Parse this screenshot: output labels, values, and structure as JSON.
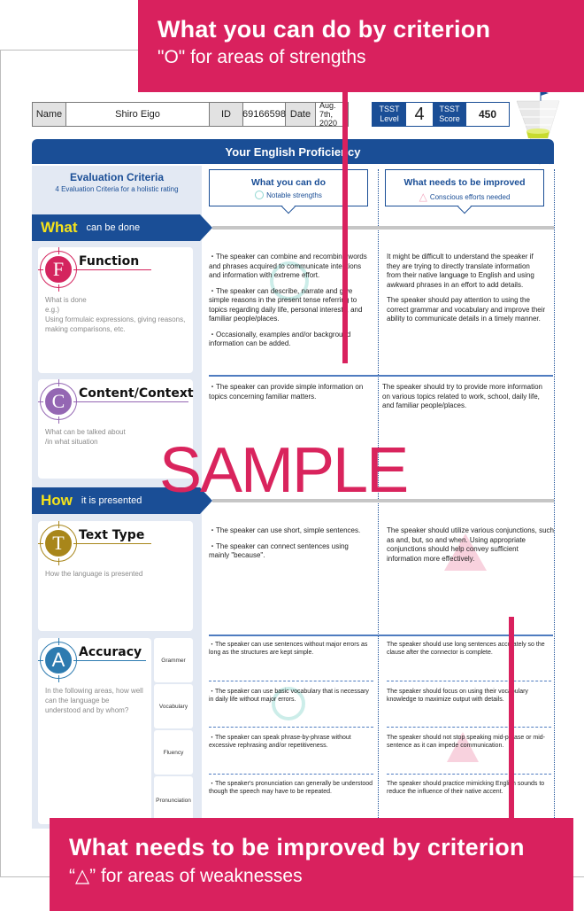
{
  "callouts": {
    "top": {
      "title": "What you can do by criterion",
      "subtitle": "\"O\" for areas of strengths"
    },
    "bottom": {
      "title": "What needs to be improved by criterion",
      "subtitle": "“△” for areas of weaknesses"
    }
  },
  "header": {
    "name_label": "Name",
    "name_value": "Shiro Eigo",
    "id_label": "ID",
    "id_value": "69166598",
    "date_label": "Date",
    "date_value": "Aug. 7th, 2020",
    "level_label": "TSST Level",
    "level_value": "4",
    "score_label": "TSST Score",
    "score_value": "450"
  },
  "title": "Your English Proficiency",
  "eval": {
    "title": "Evaluation Criteria",
    "subtitle": "4 Evaluation Criteria for a holistic rating"
  },
  "columns": {
    "can_do": {
      "title": "What you can do",
      "subtitle": "Notable strengths",
      "icon": "circle-icon"
    },
    "improve": {
      "title": "What needs to be improved",
      "subtitle": "Conscious efforts needed",
      "icon": "triangle-icon"
    }
  },
  "sections": {
    "what": {
      "big": "What",
      "small": "can be done"
    },
    "how": {
      "big": "How",
      "small": "it is presented"
    }
  },
  "criteria": {
    "function": {
      "letter": "F",
      "name": "Function",
      "color": "#d4245e",
      "desc": [
        "What is done",
        "e.g.)",
        "Using formulaic expressions, giving reasons, making comparisons, etc."
      ],
      "can_do": [
        "・The speaker can combine and recombine words and phrases acquired to communicate intentions and information with extreme effort.",
        "・The speaker can describe, narrate and give simple reasons in the present tense referring to topics regarding daily life, personal interests, and familiar people/places.",
        "・Occasionally, examples and/or background information can be added."
      ],
      "improve": [
        "It might be difficult to understand the speaker if they are trying to directly translate information from their native language to English and using awkward phrases in an effort to add details.",
        "The speaker should pay attention to using the correct grammar and vocabulary and improve their ability to communicate details in a timely manner."
      ]
    },
    "content": {
      "letter": "C",
      "name": "Content/Context",
      "color": "#9467b3",
      "desc": [
        "What can be talked about",
        "/in what situation"
      ],
      "can_do": [
        "・The speaker can provide simple information on topics concerning familiar matters."
      ],
      "improve": [
        "The speaker should try to provide more information on various topics related to work, school, daily life, and familiar people/places."
      ]
    },
    "text_type": {
      "letter": "T",
      "name": "Text Type",
      "color": "#a8861a",
      "desc": [
        "How the language is presented"
      ],
      "can_do": [
        "・The speaker can use short, simple sentences.",
        "・The speaker can connect sentences using mainly \"because\"."
      ],
      "improve": [
        "The speaker should utilize various conjunctions, such as and, but, so and when. Using appropriate conjunctions should help convey sufficient information more effectively."
      ]
    },
    "accuracy": {
      "letter": "A",
      "name": "Accuracy",
      "color": "#2d7bb0",
      "desc": [
        "In the following areas, how well can the language be understood and by whom?"
      ],
      "sub": [
        {
          "label": "Grammer",
          "can_do": "・The speaker can use sentences without major errors as long as the structures are kept simple.",
          "improve": "The speaker should use long sentences accurately so the clause after the connector is complete."
        },
        {
          "label": "Vocabulary",
          "can_do": "・The speaker can use basic vocabulary that is necessary in daily life without major errors.",
          "improve": "The speaker should focus on using their vocabulary knowledge to maximize output with details."
        },
        {
          "label": "Fluency",
          "can_do": "・The speaker can speak phrase-by-phrase without excessive rephrasing and/or repetitiveness.",
          "improve": "The speaker should not stop speaking mid-phrase or mid-sentence as it can impede communication."
        },
        {
          "label": "Pronunciation",
          "can_do": "・The speaker's pronunciation can generally be understood though the speech may have to be repeated.",
          "improve": "The speaker should practice mimicking English sounds to reduce the influence of their native accent."
        }
      ]
    }
  },
  "watermark": "SAMPLE",
  "colors": {
    "brand_blue": "#1a4e96",
    "callout_red": "#d9215e",
    "accent_yellow": "#f5e31a"
  }
}
